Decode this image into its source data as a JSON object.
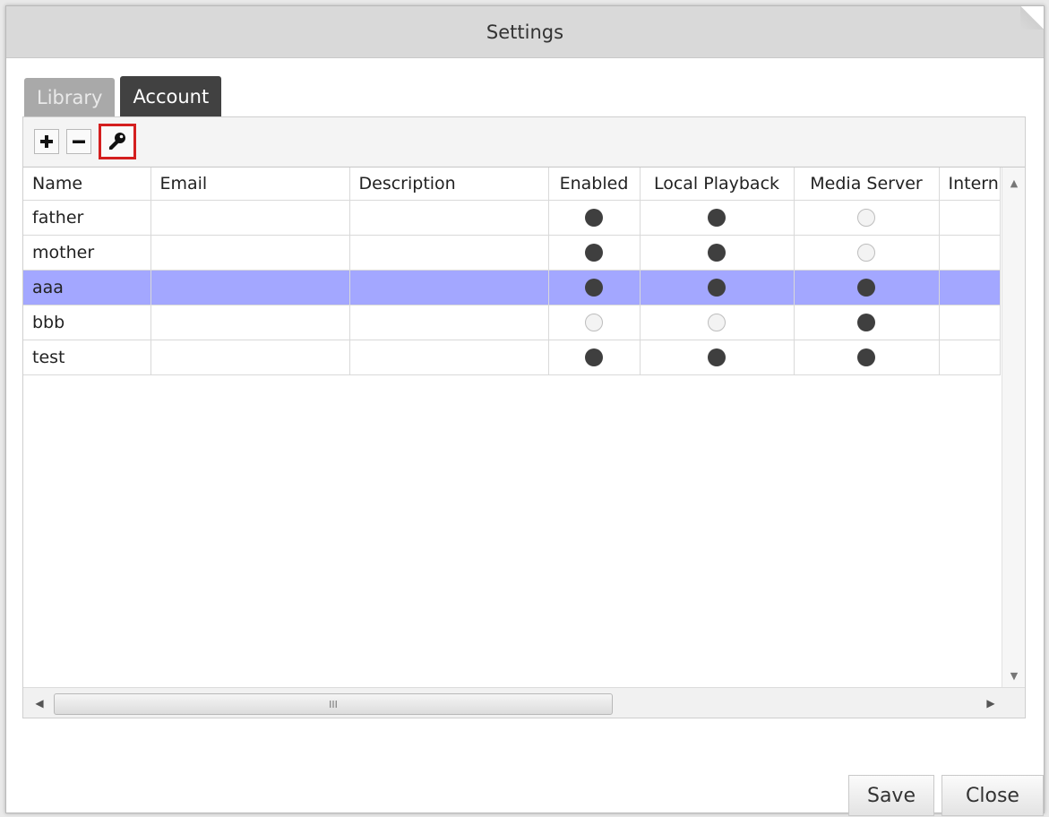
{
  "window": {
    "title": "Settings"
  },
  "tabs": [
    {
      "label": "Library",
      "active": false
    },
    {
      "label": "Account",
      "active": true
    }
  ],
  "toolbar": {
    "add_icon": "plus-icon",
    "remove_icon": "minus-icon",
    "password_icon": "key-icon"
  },
  "grid": {
    "columns": [
      "Name",
      "Email",
      "Description",
      "Enabled",
      "Local Playback",
      "Media Server",
      "Intern"
    ],
    "rows": [
      {
        "name": "father",
        "email": "",
        "description": "",
        "enabled": true,
        "local_playback": true,
        "media_server": false,
        "selected": false
      },
      {
        "name": "mother",
        "email": "",
        "description": "",
        "enabled": true,
        "local_playback": true,
        "media_server": false,
        "selected": false
      },
      {
        "name": "aaa",
        "email": "",
        "description": "",
        "enabled": true,
        "local_playback": true,
        "media_server": true,
        "selected": true
      },
      {
        "name": "bbb",
        "email": "",
        "description": "",
        "enabled": false,
        "local_playback": false,
        "media_server": true,
        "selected": false
      },
      {
        "name": "test",
        "email": "",
        "description": "",
        "enabled": true,
        "local_playback": true,
        "media_server": true,
        "selected": false
      }
    ],
    "hscroll_grip": "III"
  },
  "buttons": {
    "save": "Save",
    "close": "Close"
  },
  "colors": {
    "selected_row": "#a3a7ff",
    "active_tab": "#414141",
    "highlight_border": "#d41f1f"
  }
}
